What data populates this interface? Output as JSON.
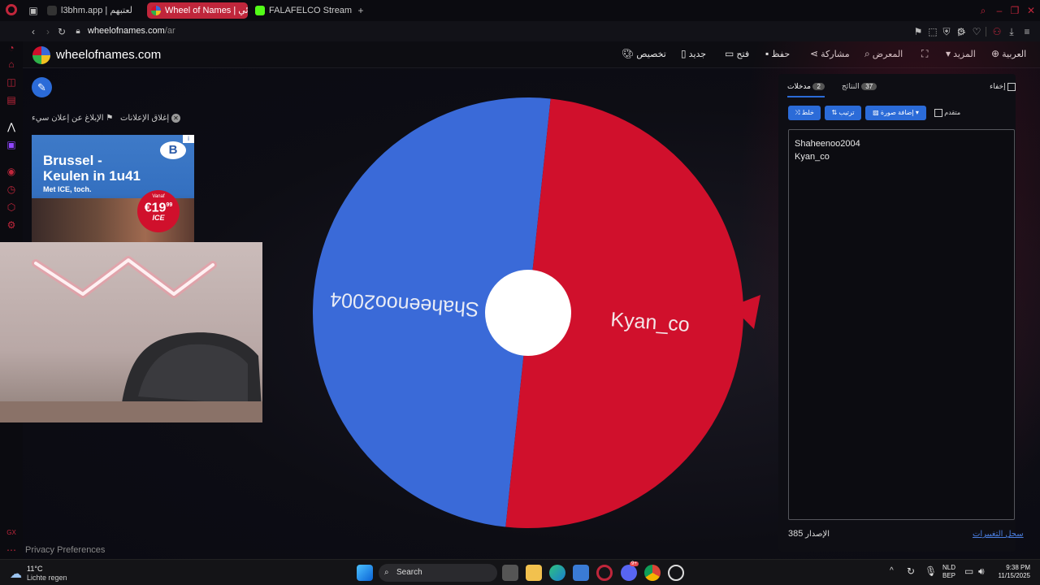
{
  "browser": {
    "tabs": [
      {
        "label": "l3bhm.app | لعتبهم",
        "active": false
      },
      {
        "label": "Wheel of Names | عشوائي",
        "active": true
      },
      {
        "label": "FALAFELCO Stream - Wat",
        "active": false
      }
    ],
    "url_main": "wheelofnames.com",
    "url_path": "/ar"
  },
  "site": {
    "logo_text": "wheelofnames.com",
    "nav": {
      "customize": "تخصيص",
      "new": "جديد",
      "open": "فتح",
      "save": "حفظ",
      "share": "مشاركة",
      "gallery": "المعرض",
      "more": "المزيد",
      "language": "العربية"
    },
    "report_ad": "الإبلاغ عن إعلان سيء",
    "close_ads": "إغلاق الإعلانات",
    "privacy": "Privacy Preferences"
  },
  "ad": {
    "line1": "Brussel -",
    "line2": "Keulen in 1u41",
    "line3": "Met ICE, toch.",
    "price_small": "Vanaf",
    "price": "€19",
    "price_cents": "99",
    "price_tag": "ICE",
    "brand": "B"
  },
  "panel": {
    "hide_label": "إخفاء",
    "tab_results": "النتائج",
    "results_count": "37",
    "tab_entries": "مدخلات",
    "entries_count": "2",
    "advanced_label": "متقدم",
    "add_image": "إضافة صورة",
    "sort": "ترتيب",
    "shuffle": "خلط",
    "entries": [
      "Shaheenoo2004",
      "Kyan_co"
    ],
    "version_label": "الإصدار",
    "version": "385",
    "changelog": "سجل التغييرات"
  },
  "wheel": {
    "slices": [
      {
        "label": "Shaheenoo2004",
        "color": "#3a6ad8"
      },
      {
        "label": "Kyan_co",
        "color": "#d0102c"
      }
    ],
    "pointer_color": "#d0102c"
  },
  "taskbar": {
    "weather_temp": "11°C",
    "weather_desc": "Lichte regen",
    "search": "Search",
    "lang_top": "NLD",
    "lang_bottom": "BEP",
    "time": "9:38 PM",
    "date": "11/15/2025",
    "discord_badge": "9+"
  },
  "colors": {
    "accent": "#2b6bd8",
    "brand_red": "#c0263b"
  }
}
